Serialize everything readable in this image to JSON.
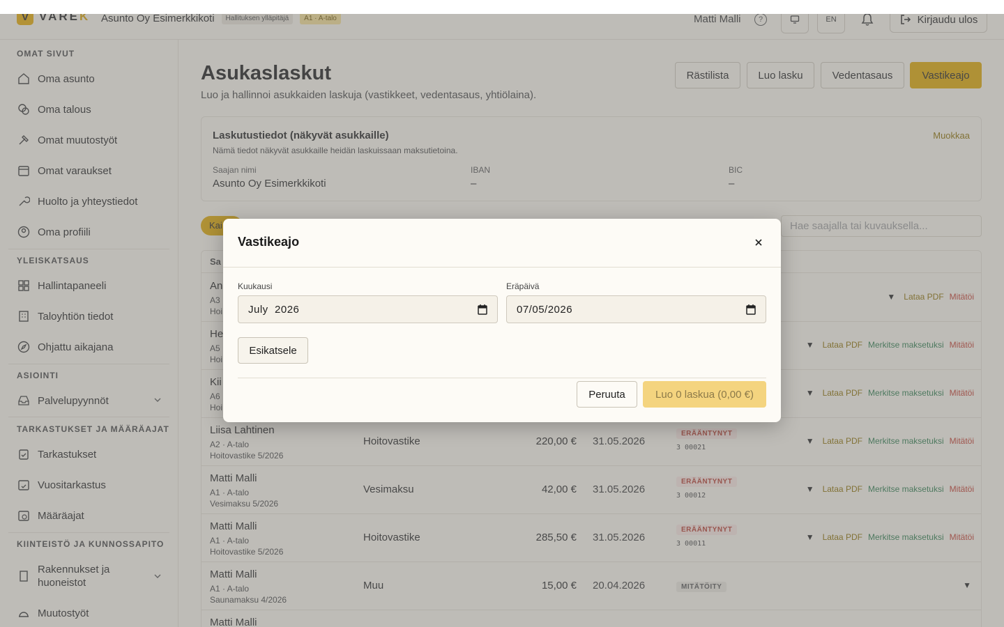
{
  "header": {
    "logo_mark": "V",
    "logo_text_a": "VARE",
    "logo_text_b": "K",
    "org_name": "Asunto Oy Esimerkkikoti",
    "role_chip": "Hallituksen ylläpitäjä",
    "unit_chip": "A1 · A-talo",
    "user_name": "Matti Malli",
    "lang": "EN",
    "logout_label": "Kirjaudu ulos"
  },
  "sidebar": {
    "sections": [
      {
        "title": "OMAT SIVUT",
        "items": [
          "Oma asunto",
          "Oma talous",
          "Omat muutostyöt",
          "Omat varaukset",
          "Huolto ja yhteystiedot",
          "Oma profiili"
        ]
      },
      {
        "title": "YLEISKATSAUS",
        "items": [
          "Hallintapaneeli",
          "Taloyhtiön tiedot",
          "Ohjattu aikajana"
        ]
      },
      {
        "title": "ASIOINTI",
        "items": [
          "Palvelupyynnöt"
        ]
      },
      {
        "title": "TARKASTUKSET JA MÄÄRÄAJAT",
        "items": [
          "Tarkastukset",
          "Vuositarkastus",
          "Määräajat"
        ]
      },
      {
        "title": "KIINTEISTÖ JA KUNNOSSAPITO",
        "items": [
          "Rakennukset ja huoneistot",
          "Muutostyöt"
        ]
      }
    ]
  },
  "page": {
    "title": "Asukaslaskut",
    "subtitle": "Luo ja hallinnoi asukkaiden laskuja (vastikkeet, vedentasaus, yhtiölaina).",
    "actions": [
      "Rästilista",
      "Luo lasku",
      "Vedentasaus",
      "Vastikeajo"
    ]
  },
  "billing": {
    "title": "Laskutustiedot (näkyvät asukkaille)",
    "desc": "Nämä tiedot näkyvät asukkaille heidän laskuissaan maksutietoina.",
    "edit": "Muokkaa",
    "fields": [
      {
        "label": "Saajan nimi",
        "value": "Asunto Oy Esimerkkikoti"
      },
      {
        "label": "IBAN",
        "value": "–"
      },
      {
        "label": "BIC",
        "value": "–"
      }
    ]
  },
  "filters": {
    "active": "Kai",
    "search_placeholder": "Hae saajalla tai kuvauksella..."
  },
  "table": {
    "header_first": "Sa",
    "actions": {
      "pdf": "Lataa PDF",
      "paid": "Merkitse maksetuksi",
      "void": "Mitätöi"
    },
    "rows": [
      {
        "name": "An",
        "unit": "A3",
        "desc": "Hoi",
        "type": "",
        "amount": "",
        "date": "",
        "status": "",
        "ref": "",
        "paid": false,
        "void": true,
        "pdf": true
      },
      {
        "name": "He",
        "unit": "A5",
        "desc": "Hoi",
        "type": "",
        "amount": "",
        "date": "",
        "status": "",
        "ref": "",
        "paid": true,
        "void": true,
        "pdf": true
      },
      {
        "name": "Kii",
        "unit": "A6",
        "desc": "Hoi",
        "type": "",
        "amount": "",
        "date": "",
        "status": "",
        "ref": "",
        "paid": true,
        "void": true,
        "pdf": true
      },
      {
        "name": "Liisa Lahtinen",
        "unit": "A2 · A-talo",
        "desc": "Hoitovastike 5/2026",
        "type": "Hoitovastike",
        "amount": "220,00 €",
        "date": "31.05.2026",
        "status": "ERÄÄNTYNYT",
        "ref": "3 00021",
        "paid": true,
        "void": true,
        "pdf": true
      },
      {
        "name": "Matti Malli",
        "unit": "A1 · A-talo",
        "desc": "Vesimaksu 5/2026",
        "type": "Vesimaksu",
        "amount": "42,00 €",
        "date": "31.05.2026",
        "status": "ERÄÄNTYNYT",
        "ref": "3 00012",
        "paid": true,
        "void": true,
        "pdf": true
      },
      {
        "name": "Matti Malli",
        "unit": "A1 · A-talo",
        "desc": "Hoitovastike 5/2026",
        "type": "Hoitovastike",
        "amount": "285,50 €",
        "date": "31.05.2026",
        "status": "ERÄÄNTYNYT",
        "ref": "3 00011",
        "paid": true,
        "void": true,
        "pdf": true
      },
      {
        "name": "Matti Malli",
        "unit": "A1 · A-talo",
        "desc": "Saunamaksu 4/2026",
        "type": "Muu",
        "amount": "15,00 €",
        "date": "20.04.2026",
        "status": "MITÄTÖITY",
        "ref": "",
        "paid": false,
        "void": false,
        "pdf": false
      },
      {
        "name": "Matti Malli",
        "unit": "",
        "desc": "",
        "type": "",
        "amount": "",
        "date": "",
        "status": "",
        "ref": "",
        "paid": false,
        "void": false,
        "pdf": false
      }
    ]
  },
  "modal": {
    "title": "Vastikeajo",
    "month_label": "Kuukausi",
    "month_value": "July  2026",
    "due_label": "Eräpäivä",
    "due_value": "07/05/2026",
    "preview": "Esikatsele",
    "cancel": "Peruuta",
    "create": "Luo 0 laskua (0,00 €)"
  }
}
